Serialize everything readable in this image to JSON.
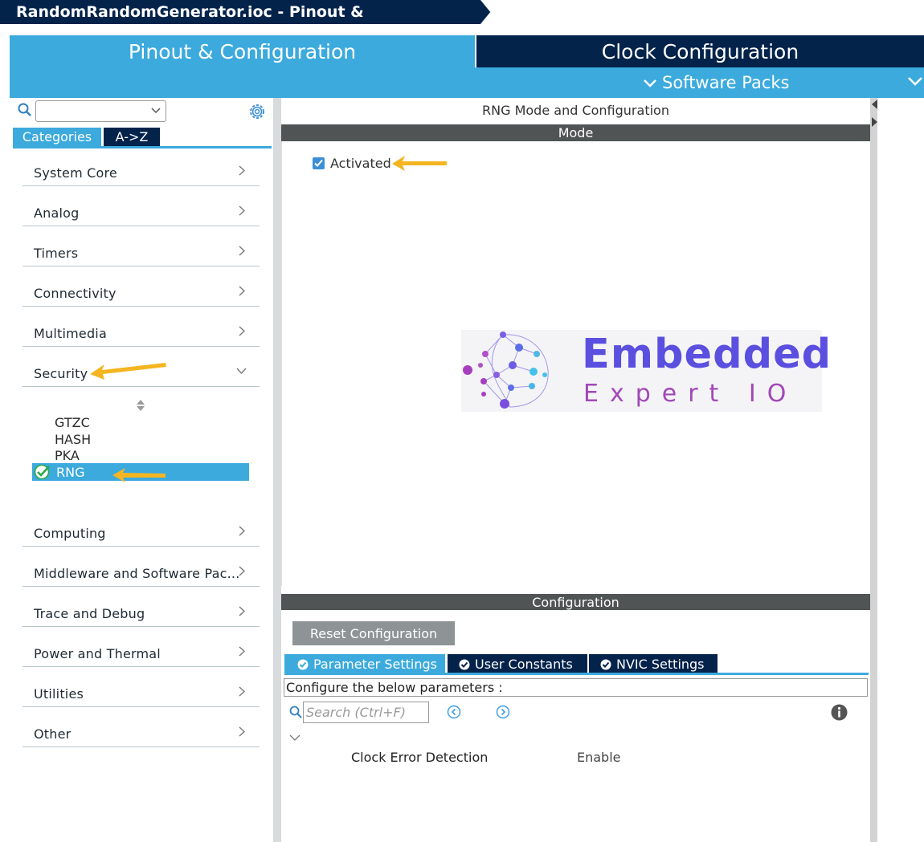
{
  "window": {
    "title": "RandomRandomGenerator.ioc - Pinout & Configuration"
  },
  "tabs": {
    "pinout": "Pinout & Configuration",
    "clock": "Clock Configuration",
    "software_packs": "Software Packs"
  },
  "sidebar": {
    "search_value": "",
    "view_buttons": {
      "categories": "Categories",
      "atoz": "A->Z"
    },
    "categories": [
      {
        "label": "System Core"
      },
      {
        "label": "Analog"
      },
      {
        "label": "Timers"
      },
      {
        "label": "Connectivity"
      },
      {
        "label": "Multimedia"
      },
      {
        "label": "Security",
        "expanded": true
      },
      {
        "label": "Computing"
      },
      {
        "label": "Middleware and Software Pac..."
      },
      {
        "label": "Trace and Debug"
      },
      {
        "label": "Power and Thermal"
      },
      {
        "label": "Utilities"
      },
      {
        "label": "Other"
      }
    ],
    "security_items": [
      "GTZC",
      "HASH",
      "PKA",
      "RNG"
    ],
    "selected_item": "RNG"
  },
  "main": {
    "title": "RNG Mode and Configuration",
    "mode_header": "Mode",
    "activated": {
      "label": "Activated",
      "checked": true
    },
    "logo": {
      "line1": "Embedded",
      "line2": "Expert IO"
    },
    "configuration_header": "Configuration",
    "reset_button": "Reset Configuration",
    "param_tabs": [
      "Parameter Settings",
      "User Constants",
      "NVIC Settings"
    ],
    "configure_text": "Configure the below parameters :",
    "search_placeholder": "Search (Ctrl+F)",
    "parameters": [
      {
        "name": "Clock Error Detection",
        "value": "Enable"
      }
    ]
  },
  "colors": {
    "dark_navy": "#03234b",
    "accent_blue": "#3caadd",
    "annotation_arrow": "#f4b521"
  }
}
